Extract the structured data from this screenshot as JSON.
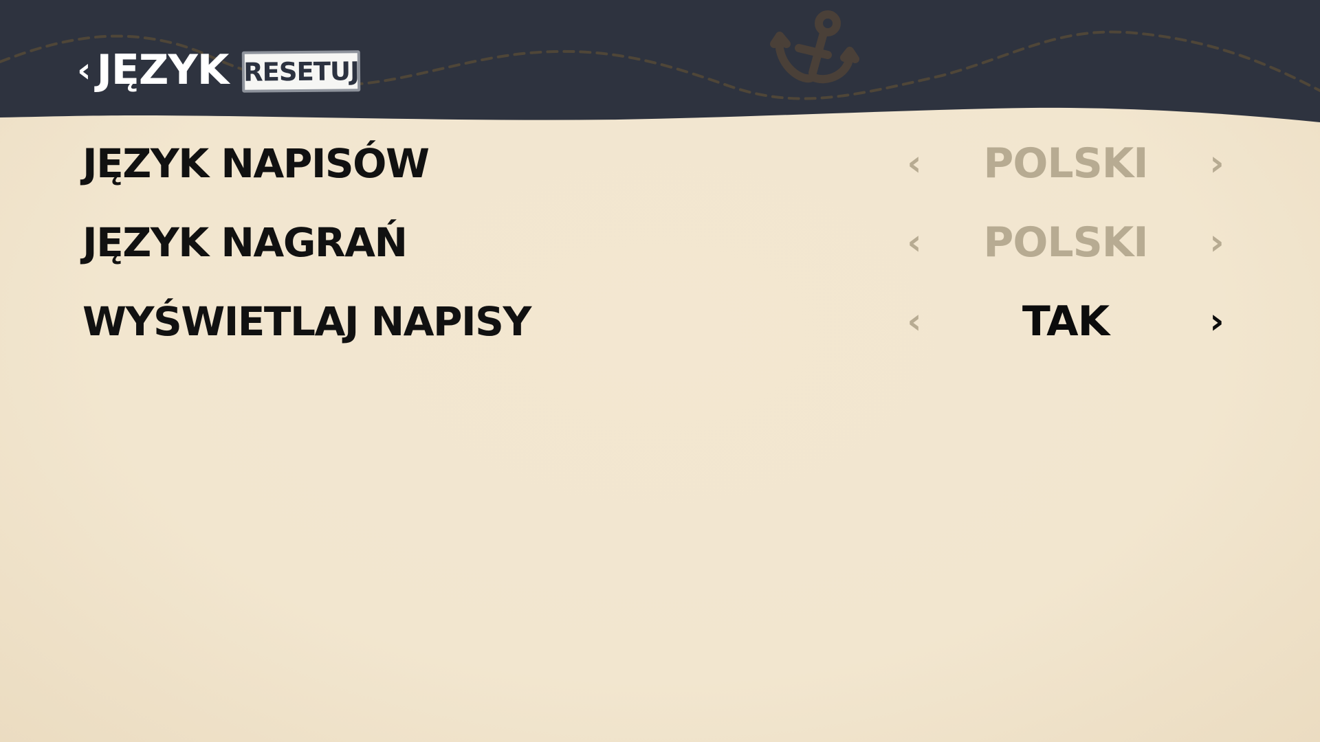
{
  "header": {
    "back_chevron": "‹",
    "title": "JĘZYK",
    "reset_label": "RESETUJ",
    "emblem": "anchor-icon",
    "background_color": "#2e333f",
    "accent_color": "#4a4038"
  },
  "settings": [
    {
      "label": "JĘZYK NAPISÓW",
      "prev_arrow": "‹",
      "value": "POLSKI",
      "next_arrow": "›",
      "enabled": false
    },
    {
      "label": "JĘZYK NAGRAŃ",
      "prev_arrow": "‹",
      "value": "POLSKI",
      "next_arrow": "›",
      "enabled": false
    },
    {
      "label": "WYŚWIETLAJ NAPISY",
      "prev_arrow": "‹",
      "value": "TAK",
      "next_arrow": "›",
      "enabled": true
    }
  ],
  "colors": {
    "background": "#f2e6cf",
    "text": "#111111",
    "muted_value": "#b7ab92"
  }
}
